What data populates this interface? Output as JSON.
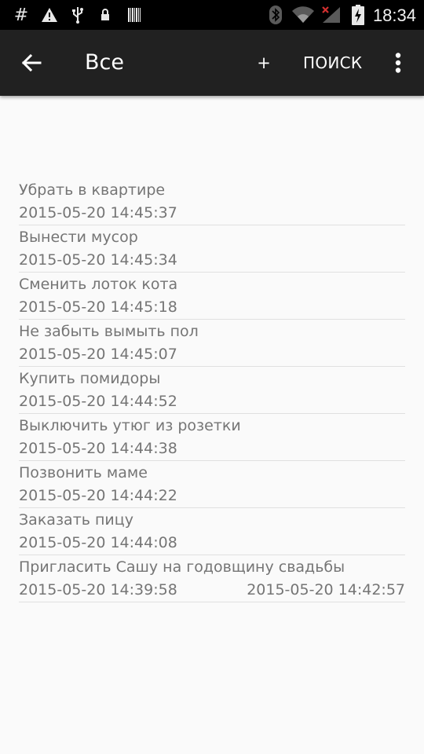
{
  "status_bar": {
    "time": "18:34",
    "icons": [
      "hash-icon",
      "warning-icon",
      "usb-icon",
      "lock-icon",
      "barcode-icon",
      "bluetooth-icon",
      "wifi-icon",
      "signal-off-icon",
      "battery-charging-icon"
    ]
  },
  "app_bar": {
    "title": "Все",
    "add_label": "+",
    "search_label": "ПОИСК"
  },
  "tasks": [
    {
      "title": "Убрать в квартире",
      "created": "2015-05-20 14:45:37",
      "done": ""
    },
    {
      "title": "Вынести мусор",
      "created": "2015-05-20 14:45:34",
      "done": ""
    },
    {
      "title": "Сменить лоток кота",
      "created": "2015-05-20 14:45:18",
      "done": ""
    },
    {
      "title": "Не забыть вымыть пол",
      "created": "2015-05-20 14:45:07",
      "done": ""
    },
    {
      "title": "Купить помидоры",
      "created": "2015-05-20 14:44:52",
      "done": ""
    },
    {
      "title": "Выключить утюг из розетки",
      "created": "2015-05-20 14:44:38",
      "done": ""
    },
    {
      "title": "Позвонить маме",
      "created": "2015-05-20 14:44:22",
      "done": ""
    },
    {
      "title": "Заказать пицу",
      "created": "2015-05-20 14:44:08",
      "done": ""
    },
    {
      "title": "Пригласить Сашу на годовщину свадьбы",
      "created": "2015-05-20 14:39:58",
      "done": "2015-05-20 14:42:57"
    }
  ]
}
